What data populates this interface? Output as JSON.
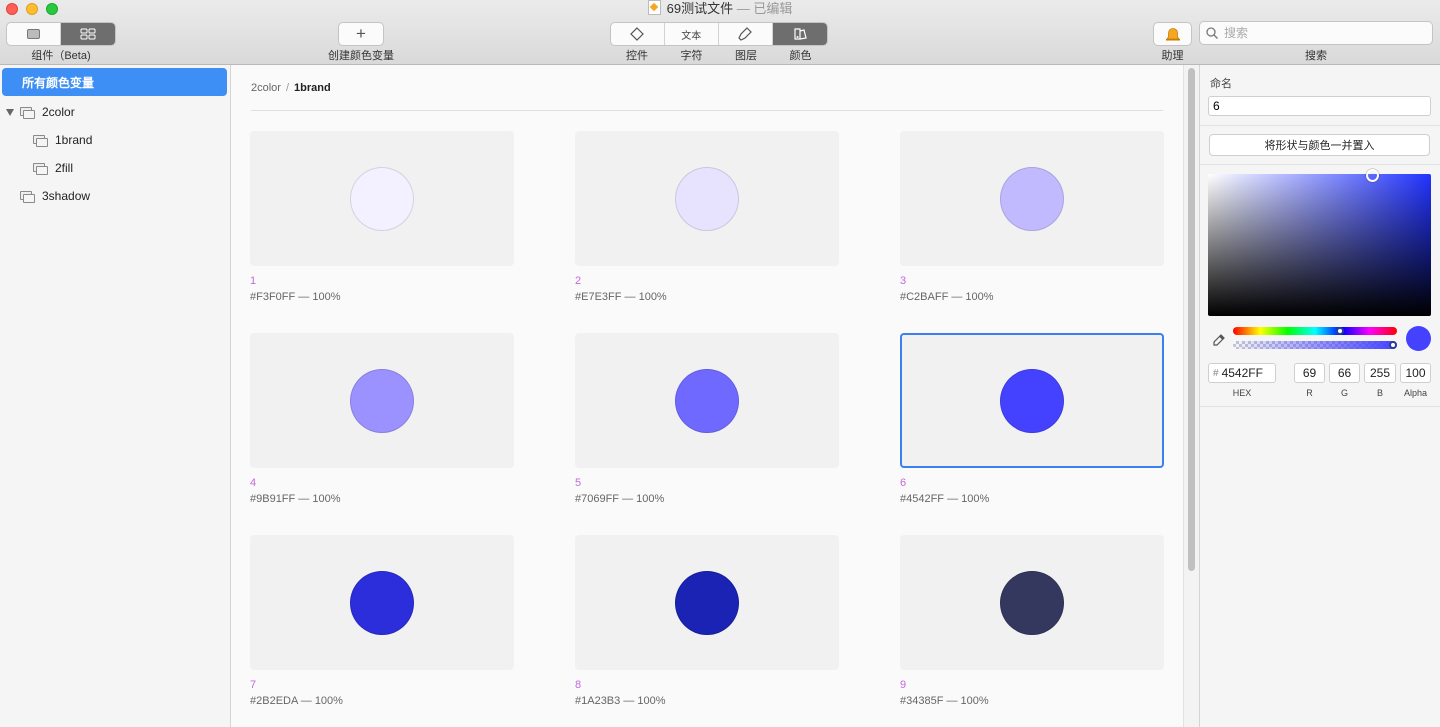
{
  "window": {
    "file_name": "69测试文件",
    "edited_suffix": "— 已编辑"
  },
  "toolbar": {
    "components_label": "组件（Beta)",
    "create_label": "创建颜色变量",
    "create_icon": "plus-icon",
    "segments": [
      {
        "label": "控件",
        "icon": "diamond-icon"
      },
      {
        "label": "字符",
        "icon_text": "文本"
      },
      {
        "label": "图层",
        "icon": "brush-icon"
      },
      {
        "label": "颜色",
        "icon": "color-palette-icon",
        "active": true
      }
    ],
    "assistant_label": "助理",
    "search_label": "搜索",
    "search_placeholder": "搜索"
  },
  "sidebar": {
    "all_label": "所有颜色变量",
    "groups": [
      {
        "label": "2color",
        "expanded": true,
        "children": [
          {
            "label": "1brand"
          },
          {
            "label": "2fill"
          }
        ]
      },
      {
        "label": "3shadow"
      }
    ]
  },
  "breadcrumb": {
    "parent": "2color",
    "current": "1brand"
  },
  "colors": [
    {
      "name": "1",
      "hex": "#F3F0FF",
      "value_text": "#F3F0FF — 100%"
    },
    {
      "name": "2",
      "hex": "#E7E3FF",
      "value_text": "#E7E3FF — 100%"
    },
    {
      "name": "3",
      "hex": "#C2BAFF",
      "value_text": "#C2BAFF — 100%"
    },
    {
      "name": "4",
      "hex": "#9B91FF",
      "value_text": "#9B91FF — 100%"
    },
    {
      "name": "5",
      "hex": "#7069FF",
      "value_text": "#7069FF — 100%"
    },
    {
      "name": "6",
      "hex": "#4542FF",
      "value_text": "#4542FF — 100%",
      "selected": true
    },
    {
      "name": "7",
      "hex": "#2B2EDA",
      "value_text": "#2B2EDA — 100%"
    },
    {
      "name": "8",
      "hex": "#1A23B3",
      "value_text": "#1A23B3 — 100%"
    },
    {
      "name": "9",
      "hex": "#34385F",
      "value_text": "#34385F — 100%"
    }
  ],
  "inspector": {
    "name_label": "命名",
    "name_value": "6",
    "apply_button": "将形状与颜色一并置入",
    "hex_hash": "#",
    "hex_value": "4542FF",
    "r": "69",
    "g": "66",
    "b": "255",
    "alpha": "100",
    "hex_label": "HEX",
    "r_label": "R",
    "g_label": "G",
    "b_label": "B",
    "alpha_label": "Alpha",
    "current_color": "#4542FF",
    "hue_position": 0.66,
    "alpha_position": 1.0
  }
}
